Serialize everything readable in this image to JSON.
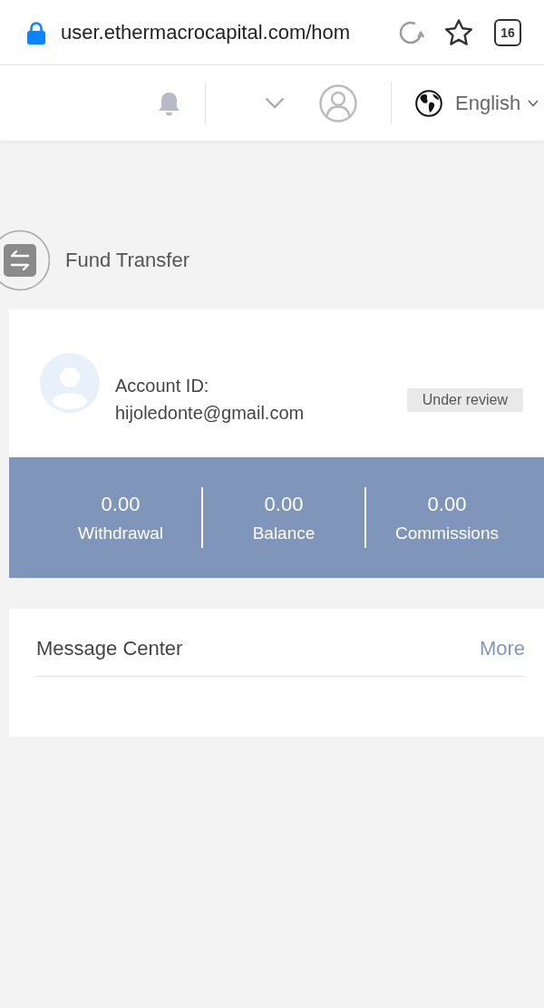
{
  "browser": {
    "url": "user.ethermacrocapital.com/hom",
    "tab_count": "16"
  },
  "header": {
    "language": "English"
  },
  "fund_transfer": {
    "label": "Fund Transfer"
  },
  "account": {
    "id_label": "Account ID:",
    "email": "hijoledonte@gmail.com",
    "status": "Under review"
  },
  "stats": [
    {
      "value": "0.00",
      "label": "Withdrawal"
    },
    {
      "value": "0.00",
      "label": "Balance"
    },
    {
      "value": "0.00",
      "label": "Commissions"
    }
  ],
  "messages": {
    "title": "Message Center",
    "more": "More"
  }
}
